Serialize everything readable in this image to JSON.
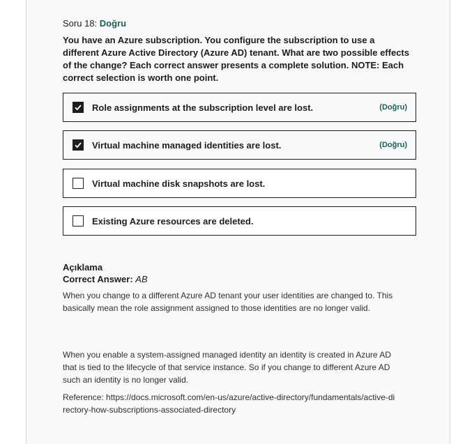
{
  "question": {
    "number_label": "Soru 18:",
    "status": "Doğru",
    "text": "You have an Azure subscription. You configure the subscription to use a different Azure Active Directory (Azure AD) tenant. What are two possible effects of the change? Each correct answer presents a complete solution. NOTE: Each correct selection is worth one point."
  },
  "options": [
    {
      "label": "Role assignments at the subscription level are lost.",
      "checked": true,
      "mark": "(Doğru)"
    },
    {
      "label": "Virtual machine managed identities are lost.",
      "checked": true,
      "mark": "(Doğru)"
    },
    {
      "label": "Virtual machine disk snapshots are lost.",
      "checked": false,
      "mark": ""
    },
    {
      "label": "Existing Azure resources are deleted.",
      "checked": false,
      "mark": ""
    }
  ],
  "explanation": {
    "title": "Açıklama",
    "correct_answer_label": "Correct Answer:",
    "correct_answer_value": "AB",
    "paragraph1": "When you change to a different Azure AD tenant your user identities are changed to. This basically mean the role assignment assigned to those identities are no longer valid.",
    "paragraph2": "When you enable a system-assigned managed identity an identity is created in Azure AD that is tied to the lifecycle of that service instance. So if you change to different Azure AD such an identity is no longer valid.",
    "reference": "Reference: https://docs.microsoft.com/en-us/azure/active-directory/fundamentals/active-directory-how-subscriptions-associated-directory"
  },
  "colors": {
    "correct": "#1e6055",
    "panel_bg": "#f7f9fa",
    "border": "#1c1d1f"
  }
}
